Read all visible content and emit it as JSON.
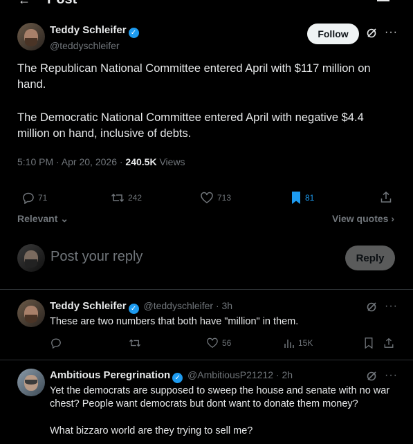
{
  "header": {
    "title": "Post"
  },
  "post": {
    "author_name": "Teddy Schleifer",
    "author_handle": "@teddyschleifer",
    "follow_label": "Follow",
    "paragraphs": [
      "The Republican National Committee entered April with $117 million on hand.",
      "The Democratic National Committee entered April with negative $4.4 million on hand, inclusive of debts."
    ],
    "timestamp": "5:10 PM · Apr 20, 2026 · ",
    "views_count": "240.5K",
    "views_label": " Views",
    "replies": "71",
    "reposts": "242",
    "likes": "713",
    "bookmarks": "81",
    "relevant_label": "Relevant",
    "view_quotes_label": "View quotes"
  },
  "compose": {
    "placeholder": "Post your reply",
    "reply_label": "Reply"
  },
  "replies": [
    {
      "author_name": "Teddy Schleifer",
      "author_handle": "@teddyschleifer · 3h",
      "text": "These are two numbers that both have \"million\" in them.",
      "likes": "56",
      "views": "15K"
    },
    {
      "author_name": "Ambitious Peregrination",
      "author_handle": "@AmbitiousP21212 · 2h",
      "text_1": "Yet the democrats are supposed to sweep the house and senate with no war chest? People want democrats but dont want to donate them money?",
      "text_2": "What bizzaro world are they trying to sell me?"
    }
  ],
  "colors": {
    "accent": "#1d9bf0",
    "muted": "#71767b",
    "text": "#e7e9ea",
    "background": "#000000"
  }
}
